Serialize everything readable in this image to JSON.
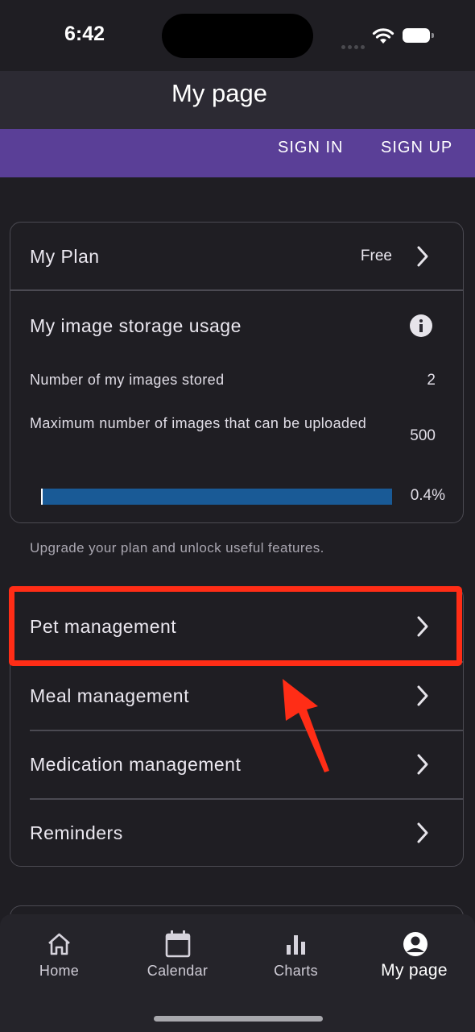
{
  "status_bar": {
    "time": "6:42"
  },
  "app_bar": {
    "title": "My page"
  },
  "auth": {
    "sign_in": "SIGN IN",
    "sign_up": "SIGN UP"
  },
  "plan_card": {
    "plan_label": "My Plan",
    "plan_value": "Free",
    "storage_title": "My image storage usage",
    "images_stored_label": "Number of my images stored",
    "images_stored_value": "2",
    "max_images_label": "Maximum number of images that can be uploaded",
    "max_images_value": "500",
    "usage_percent_text": "0.4%",
    "usage_fraction": 0.004
  },
  "hint": "Upgrade your plan and unlock useful features.",
  "management_menu": [
    {
      "label": "Pet management",
      "icon": "chevron-right-icon"
    },
    {
      "label": "Meal management",
      "icon": "chevron-right-icon"
    },
    {
      "label": "Medication management",
      "icon": "chevron-right-icon"
    },
    {
      "label": "Reminders",
      "icon": "chevron-right-icon"
    }
  ],
  "bottom_nav": [
    {
      "label": "Home",
      "icon": "home-icon",
      "active": false
    },
    {
      "label": "Calendar",
      "icon": "calendar-icon",
      "active": false
    },
    {
      "label": "Charts",
      "icon": "bar-chart-icon",
      "active": false
    },
    {
      "label": "My page",
      "icon": "account-circle-icon",
      "active": true
    }
  ],
  "colors": {
    "background": "#1f1e23",
    "app_bar": "#2c2a33",
    "auth_bar": "#5a3f97",
    "progress_track": "#195a96",
    "highlight": "#ff2d16"
  }
}
